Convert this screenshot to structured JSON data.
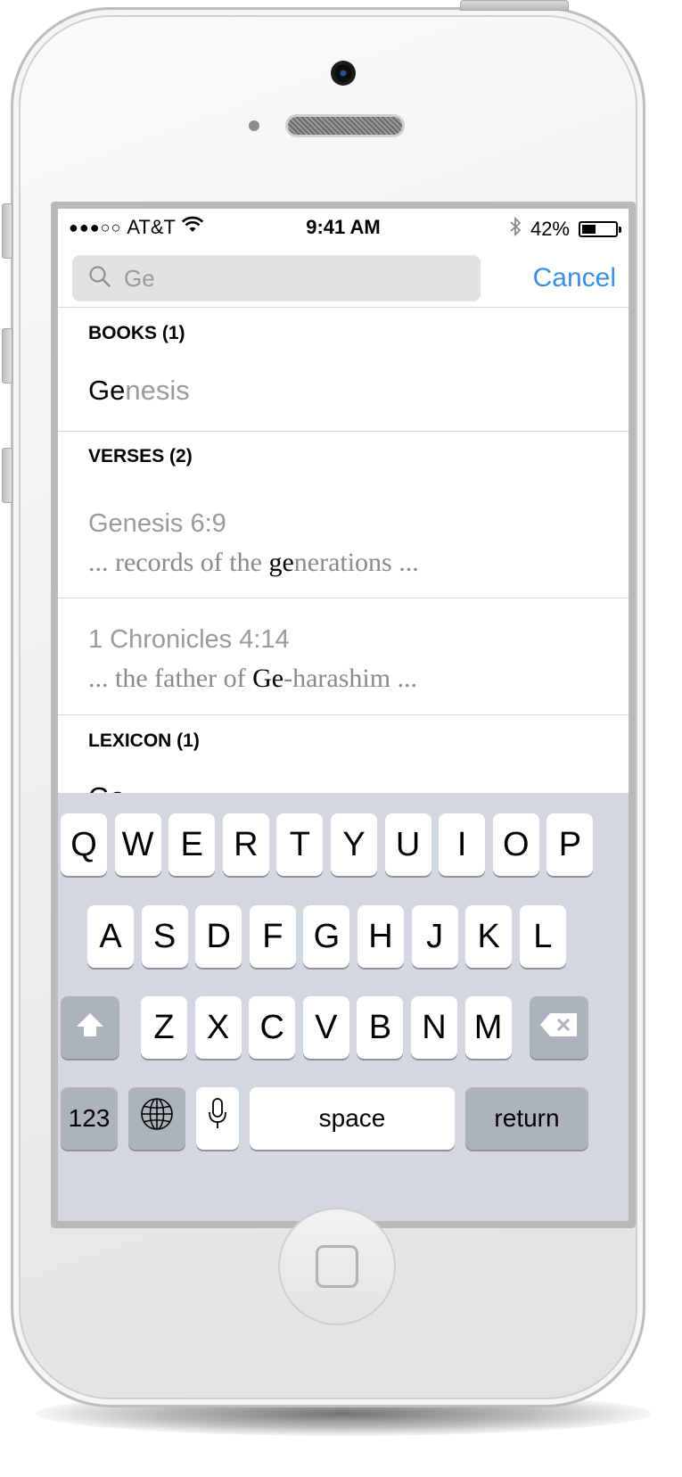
{
  "status_bar": {
    "signal_dots": "●●●○○",
    "carrier": "AT&T",
    "wifi_icon": "wifi-icon",
    "time": "9:41 AM",
    "bluetooth_icon": "bluetooth-icon",
    "battery_percent": "42%",
    "battery_level": 0.42
  },
  "search": {
    "query": "Ge",
    "search_icon": "magnifier-icon",
    "cancel_label": "Cancel"
  },
  "results": {
    "books_header": "BOOKS (1)",
    "books": [
      {
        "match": "Ge",
        "rest": "nesis"
      }
    ],
    "verses_header": "VERSES (2)",
    "verses": [
      {
        "reference": "Genesis 6:9",
        "before": "... records of the ",
        "match": "ge",
        "after": "nerations ..."
      },
      {
        "reference": "1 Chronicles 4:14",
        "before": "... the father of ",
        "match": "Ge",
        "after": "-harashim ..."
      }
    ],
    "lexicon_header": "LEXICON (1)",
    "lexicon_peek": "Ge"
  },
  "keyboard": {
    "row1": [
      "Q",
      "W",
      "E",
      "R",
      "T",
      "Y",
      "U",
      "I",
      "O",
      "P"
    ],
    "row2": [
      "A",
      "S",
      "D",
      "F",
      "G",
      "H",
      "J",
      "K",
      "L"
    ],
    "row3": [
      "Z",
      "X",
      "C",
      "V",
      "B",
      "N",
      "M"
    ],
    "numbers_label": "123",
    "space_label": "space",
    "return_label": "return",
    "shift_icon": "shift-arrow-icon",
    "delete_icon": "backspace-icon",
    "globe_icon": "globe-icon",
    "mic_icon": "microphone-icon"
  },
  "colors": {
    "accent": "#3b8ee0",
    "keyboard_bg": "#d3d7df",
    "search_field_bg": "#e2e2e2"
  }
}
